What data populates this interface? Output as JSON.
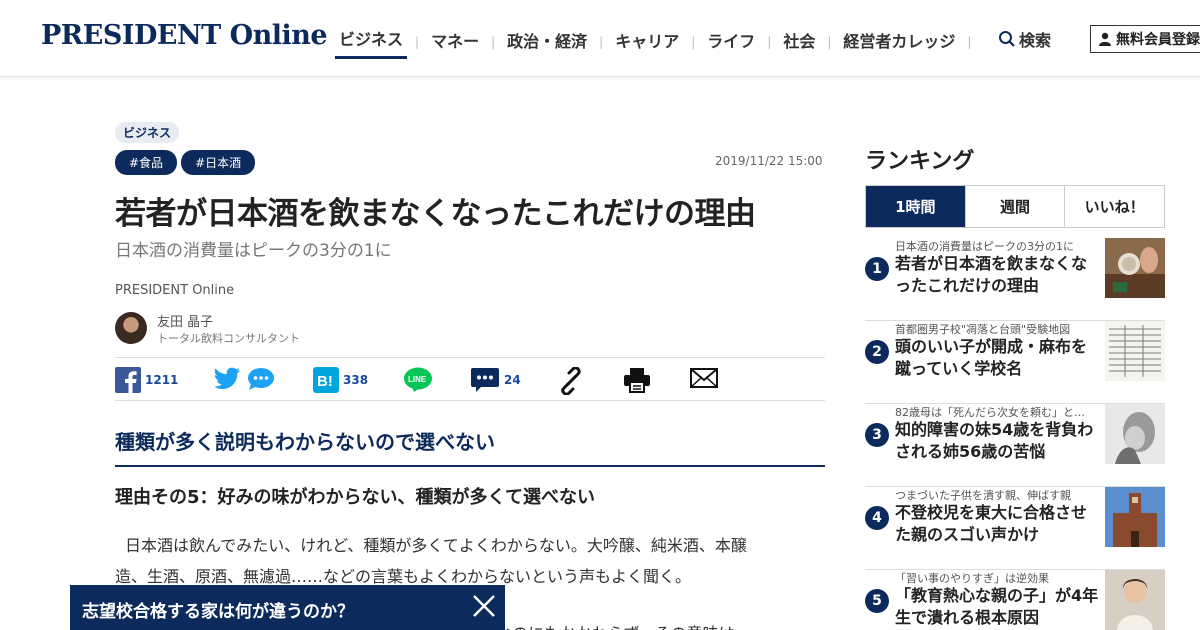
{
  "header": {
    "logo": "PRESIDENT Online",
    "nav": [
      "ビジネス",
      "マネー",
      "政治・経済",
      "キャリア",
      "ライフ",
      "社会",
      "経営者カレッジ"
    ],
    "search_label": "検索",
    "member_label": "無料会員登録"
  },
  "article": {
    "category": "ビジネス",
    "tags": [
      "#食品",
      "#日本酒"
    ],
    "date": "2019/11/22 15:00",
    "title": "若者が日本酒を飲まなくなったこれだけの理由",
    "subtitle": "日本酒の消費量はピークの3分の1に",
    "source": "PRESIDENT Online",
    "author_name": "友田 晶子",
    "author_role": "トータル飲料コンサルタント",
    "share": {
      "facebook_count": "1211",
      "hatena_count": "338",
      "comment_count": "24"
    },
    "section_heading": "種類が多く説明もわからないので選べない",
    "subheading": "理由その5：好みの味がわからない、種類が多くて選べない",
    "body_lines": [
      "日本酒は飲んでみたい、けれど、種類が多くてよくわからない。大吟醸、純米酒、本醸",
      "造、生酒、原酒、無濾過……などの言葉もよくわからないという声もよく聞く。"
    ],
    "body_tail": "…なのにもかかわらず、その意味は"
  },
  "banner": {
    "text": "志望校合格する家は何が違うのか？"
  },
  "ranking": {
    "title": "ランキング",
    "tabs": [
      "1時間",
      "週間",
      "いいね！"
    ],
    "items": [
      {
        "rank": "1",
        "kicker": "日本酒の消費量はピークの3分の1に",
        "headline": "若者が日本酒を飲まなくなったこれだけの理由"
      },
      {
        "rank": "2",
        "kicker": "首都圏男子校\"凋落と台頭\"受験地図",
        "headline": "頭のいい子が開成・麻布を蹴っていく学校名"
      },
      {
        "rank": "3",
        "kicker": "82歳母は「死んだら次女を頼む」と…",
        "headline": "知的障害の妹54歳を背負わされる姉56歳の苦悩"
      },
      {
        "rank": "4",
        "kicker": "つまづいた子供を潰す親、伸ばす親",
        "headline": "不登校児を東大に合格させた親のスゴい声かけ"
      },
      {
        "rank": "5",
        "kicker": "「習い事のやりすぎ」は逆効果",
        "headline": "「教育熱心な親の子」が4年生で潰れる根本原因"
      }
    ]
  },
  "colors": {
    "brand_navy": "#0d2a5c",
    "facebook": "#3b5998",
    "twitter": "#1da1f2",
    "hatena": "#00a4de",
    "line": "#06c755"
  }
}
